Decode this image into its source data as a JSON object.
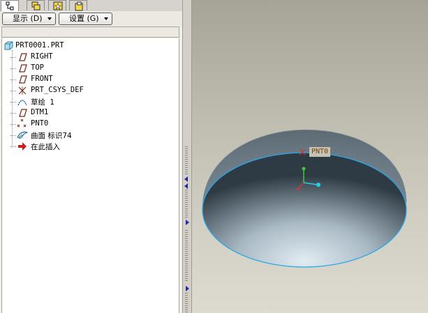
{
  "tabs": [
    {
      "icon": "model-tree-tab-icon",
      "active": true
    },
    {
      "icon": "layers-tab-icon",
      "active": false
    },
    {
      "icon": "favorites-tab-icon",
      "active": false
    },
    {
      "icon": "folder-tab-icon",
      "active": false
    }
  ],
  "toolbar": {
    "display_label": "显示 (D)",
    "settings_label": "设置 (G)"
  },
  "tree": {
    "root": "PRT0001.PRT",
    "items": [
      {
        "label": "RIGHT",
        "icon": "datum-plane-icon"
      },
      {
        "label": "TOP",
        "icon": "datum-plane-icon"
      },
      {
        "label": "FRONT",
        "icon": "datum-plane-icon"
      },
      {
        "label": "PRT_CSYS_DEF",
        "icon": "csys-icon"
      },
      {
        "label": "草绘 1",
        "icon": "sketch-icon"
      },
      {
        "label": "DTM1",
        "icon": "datum-plane-icon"
      },
      {
        "label": "PNT0",
        "icon": "datum-point-icon"
      },
      {
        "label": "曲面 标识74",
        "icon": "surface-icon"
      },
      {
        "label": "在此插入",
        "icon": "insert-here-arrow-icon"
      }
    ]
  },
  "viewport": {
    "point_label": "PNT0",
    "colors": {
      "edge": "#2aa8e8",
      "point_marker": "#c83a3a",
      "label_text": "#7a3d14"
    }
  }
}
